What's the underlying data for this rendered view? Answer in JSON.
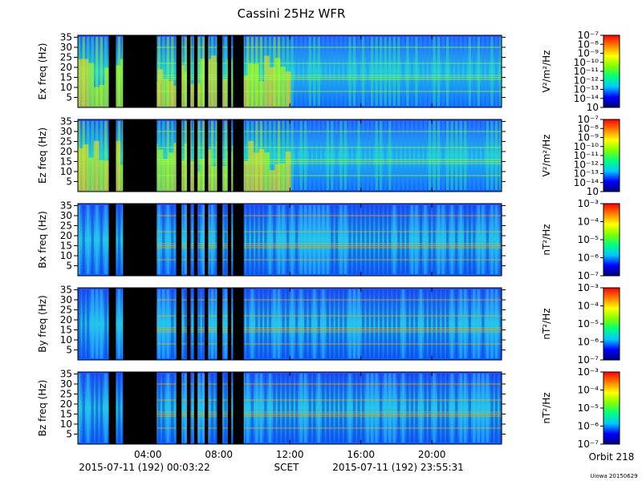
{
  "title": "Cassini 25Hz WFR",
  "footer": {
    "start_time": "2015-07-11 (192) 00:03:22",
    "axis_name": "SCET",
    "end_time": "2015-07-11 (192) 23:55:31",
    "orbit": "Orbit 218",
    "version": "Uiowa 20150629"
  },
  "chart_data": [
    {
      "type": "heatmap",
      "ylabel": "Ex freq (Hz)",
      "yticks": [
        5,
        10,
        15,
        20,
        25,
        30,
        35
      ],
      "ylim": [
        0,
        36
      ],
      "colorbar": {
        "label": "V²/m²/Hz",
        "ticks": [
          "10⁻⁷",
          "10⁻⁸",
          "10⁻⁹",
          "10⁻¹⁰",
          "10⁻¹¹",
          "10⁻¹²",
          "10⁻¹³",
          "10⁻¹⁴",
          "10"
        ]
      }
    },
    {
      "type": "heatmap",
      "ylabel": "Ez freq (Hz)",
      "yticks": [
        5,
        10,
        15,
        20,
        25,
        30,
        35
      ],
      "ylim": [
        0,
        36
      ],
      "colorbar": {
        "label": "V²/m²/Hz",
        "ticks": [
          "10⁻⁷",
          "10⁻⁸",
          "10⁻⁹",
          "10⁻¹⁰",
          "10⁻¹¹",
          "10⁻¹²",
          "10⁻¹³",
          "10⁻¹⁴",
          "10"
        ]
      }
    },
    {
      "type": "heatmap",
      "ylabel": "Bx freq (Hz)",
      "yticks": [
        5,
        10,
        15,
        20,
        25,
        30,
        35
      ],
      "ylim": [
        0,
        36
      ],
      "colorbar": {
        "label": "nT²/Hz",
        "ticks": [
          "10⁻³",
          "10⁻⁴",
          "10⁻⁵",
          "10⁻⁶",
          "10⁻⁷"
        ]
      }
    },
    {
      "type": "heatmap",
      "ylabel": "By freq (Hz)",
      "yticks": [
        5,
        10,
        15,
        20,
        25,
        30,
        35
      ],
      "ylim": [
        0,
        36
      ],
      "colorbar": {
        "label": "nT²/Hz",
        "ticks": [
          "10⁻³",
          "10⁻⁴",
          "10⁻⁵",
          "10⁻⁶",
          "10⁻⁷"
        ]
      }
    },
    {
      "type": "heatmap",
      "ylabel": "Bz freq (Hz)",
      "yticks": [
        5,
        10,
        15,
        20,
        25,
        30,
        35
      ],
      "ylim": [
        0,
        36
      ],
      "colorbar": {
        "label": "nT²/Hz",
        "ticks": [
          "10⁻³",
          "10⁻⁴",
          "10⁻⁵",
          "10⁻⁶",
          "10⁻⁷"
        ]
      }
    }
  ],
  "x_axis": {
    "unit": "hours",
    "xlim": [
      0.056,
      23.925
    ],
    "tick_labels": [
      "04:00",
      "08:00",
      "12:00",
      "16:00",
      "20:00"
    ],
    "tick_values": [
      4,
      8,
      12,
      16,
      20
    ]
  },
  "data_gaps_hours": [
    [
      1.8,
      2.2
    ],
    [
      2.6,
      4.5
    ],
    [
      5.6,
      5.9
    ],
    [
      6.2,
      6.4
    ],
    [
      6.6,
      6.8
    ],
    [
      7.2,
      7.4
    ],
    [
      7.9,
      8.2
    ],
    [
      8.5,
      8.7
    ],
    [
      8.8,
      9.4
    ]
  ],
  "noise_lines_hz": [
    8,
    14,
    15,
    16,
    22,
    30
  ],
  "colors": {
    "scale": [
      "#00007a",
      "#0000ff",
      "#00c8ff",
      "#00ff80",
      "#80ff00",
      "#ffff00",
      "#ff8000",
      "#ff0000"
    ]
  }
}
